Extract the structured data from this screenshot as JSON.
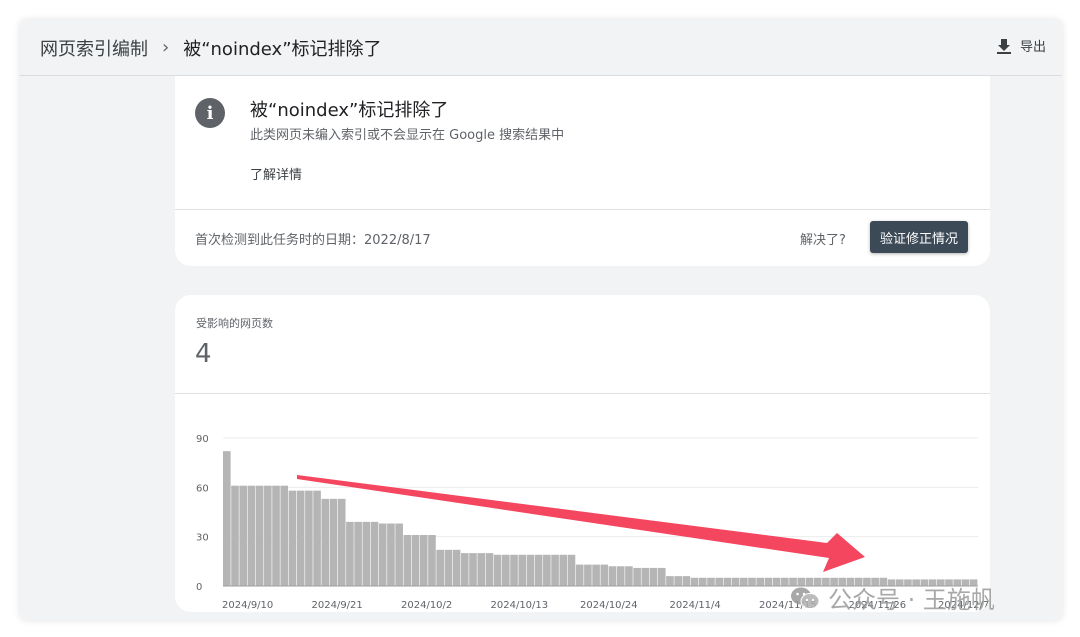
{
  "header": {
    "breadcrumb_parent": "网页索引编制",
    "breadcrumb_sep": "›",
    "breadcrumb_current": "被“noindex”标记排除了",
    "export_label": "导出"
  },
  "issue_card": {
    "title": "被“noindex”标记排除了",
    "subtitle": "此类网页未编入索引或不会显示在 Google 搜索结果中",
    "learn_more": "了解详情",
    "first_detected": "首次检测到此任务时的日期：2022/8/17",
    "resolved_prompt": "解决了?",
    "validate_button": "验证修正情况"
  },
  "affected_card": {
    "label": "受影响的网页数",
    "value": "4"
  },
  "chart_data": {
    "type": "bar",
    "ylim": [
      0,
      90
    ],
    "yticks": [
      "0",
      "30",
      "60",
      "90"
    ],
    "xticks": [
      "2024/9/10",
      "2024/9/21",
      "2024/10/2",
      "2024/10/13",
      "2024/10/24",
      "2024/11/4",
      "2024/11/15",
      "2024/11/26",
      "2024/12/7"
    ],
    "values": [
      82,
      61,
      61,
      61,
      61,
      61,
      61,
      61,
      58,
      58,
      58,
      58,
      53,
      53,
      53,
      39,
      39,
      39,
      39,
      38,
      38,
      38,
      31,
      31,
      31,
      31,
      22,
      22,
      22,
      20,
      20,
      20,
      20,
      19,
      19,
      19,
      19,
      19,
      19,
      19,
      19,
      19,
      19,
      13,
      13,
      13,
      13,
      12,
      12,
      12,
      11,
      11,
      11,
      11,
      6,
      6,
      6,
      5,
      5,
      5,
      5,
      5,
      5,
      5,
      5,
      5,
      5,
      5,
      5,
      5,
      5,
      5,
      5,
      5,
      5,
      5,
      5,
      5,
      5,
      5,
      5,
      4,
      4,
      4,
      4,
      4,
      4,
      4,
      4,
      4,
      4,
      4
    ],
    "bar_color": "#b5b5b5",
    "grid": true
  },
  "annotation": {
    "arrow_color": "#f5465f"
  },
  "watermark": {
    "text": "公众号 · 王施帆"
  }
}
